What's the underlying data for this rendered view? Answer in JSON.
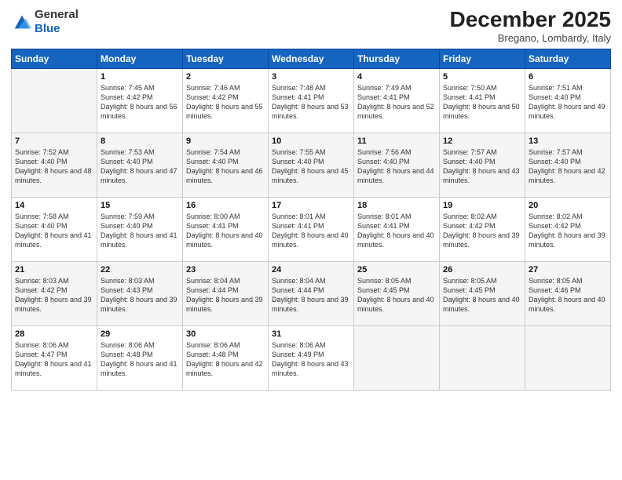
{
  "header": {
    "logo_line1": "General",
    "logo_line2": "Blue",
    "month": "December 2025",
    "location": "Bregano, Lombardy, Italy"
  },
  "days_of_week": [
    "Sunday",
    "Monday",
    "Tuesday",
    "Wednesday",
    "Thursday",
    "Friday",
    "Saturday"
  ],
  "weeks": [
    [
      {
        "day": "",
        "sunrise": "",
        "sunset": "",
        "daylight": "",
        "empty": true
      },
      {
        "day": "1",
        "sunrise": "Sunrise: 7:45 AM",
        "sunset": "Sunset: 4:42 PM",
        "daylight": "Daylight: 8 hours and 56 minutes."
      },
      {
        "day": "2",
        "sunrise": "Sunrise: 7:46 AM",
        "sunset": "Sunset: 4:42 PM",
        "daylight": "Daylight: 8 hours and 55 minutes."
      },
      {
        "day": "3",
        "sunrise": "Sunrise: 7:48 AM",
        "sunset": "Sunset: 4:41 PM",
        "daylight": "Daylight: 8 hours and 53 minutes."
      },
      {
        "day": "4",
        "sunrise": "Sunrise: 7:49 AM",
        "sunset": "Sunset: 4:41 PM",
        "daylight": "Daylight: 8 hours and 52 minutes."
      },
      {
        "day": "5",
        "sunrise": "Sunrise: 7:50 AM",
        "sunset": "Sunset: 4:41 PM",
        "daylight": "Daylight: 8 hours and 50 minutes."
      },
      {
        "day": "6",
        "sunrise": "Sunrise: 7:51 AM",
        "sunset": "Sunset: 4:40 PM",
        "daylight": "Daylight: 8 hours and 49 minutes."
      }
    ],
    [
      {
        "day": "7",
        "sunrise": "Sunrise: 7:52 AM",
        "sunset": "Sunset: 4:40 PM",
        "daylight": "Daylight: 8 hours and 48 minutes."
      },
      {
        "day": "8",
        "sunrise": "Sunrise: 7:53 AM",
        "sunset": "Sunset: 4:40 PM",
        "daylight": "Daylight: 8 hours and 47 minutes."
      },
      {
        "day": "9",
        "sunrise": "Sunrise: 7:54 AM",
        "sunset": "Sunset: 4:40 PM",
        "daylight": "Daylight: 8 hours and 46 minutes."
      },
      {
        "day": "10",
        "sunrise": "Sunrise: 7:55 AM",
        "sunset": "Sunset: 4:40 PM",
        "daylight": "Daylight: 8 hours and 45 minutes."
      },
      {
        "day": "11",
        "sunrise": "Sunrise: 7:56 AM",
        "sunset": "Sunset: 4:40 PM",
        "daylight": "Daylight: 8 hours and 44 minutes."
      },
      {
        "day": "12",
        "sunrise": "Sunrise: 7:57 AM",
        "sunset": "Sunset: 4:40 PM",
        "daylight": "Daylight: 8 hours and 43 minutes."
      },
      {
        "day": "13",
        "sunrise": "Sunrise: 7:57 AM",
        "sunset": "Sunset: 4:40 PM",
        "daylight": "Daylight: 8 hours and 42 minutes."
      }
    ],
    [
      {
        "day": "14",
        "sunrise": "Sunrise: 7:58 AM",
        "sunset": "Sunset: 4:40 PM",
        "daylight": "Daylight: 8 hours and 41 minutes."
      },
      {
        "day": "15",
        "sunrise": "Sunrise: 7:59 AM",
        "sunset": "Sunset: 4:40 PM",
        "daylight": "Daylight: 8 hours and 41 minutes."
      },
      {
        "day": "16",
        "sunrise": "Sunrise: 8:00 AM",
        "sunset": "Sunset: 4:41 PM",
        "daylight": "Daylight: 8 hours and 40 minutes."
      },
      {
        "day": "17",
        "sunrise": "Sunrise: 8:01 AM",
        "sunset": "Sunset: 4:41 PM",
        "daylight": "Daylight: 8 hours and 40 minutes."
      },
      {
        "day": "18",
        "sunrise": "Sunrise: 8:01 AM",
        "sunset": "Sunset: 4:41 PM",
        "daylight": "Daylight: 8 hours and 40 minutes."
      },
      {
        "day": "19",
        "sunrise": "Sunrise: 8:02 AM",
        "sunset": "Sunset: 4:42 PM",
        "daylight": "Daylight: 8 hours and 39 minutes."
      },
      {
        "day": "20",
        "sunrise": "Sunrise: 8:02 AM",
        "sunset": "Sunset: 4:42 PM",
        "daylight": "Daylight: 8 hours and 39 minutes."
      }
    ],
    [
      {
        "day": "21",
        "sunrise": "Sunrise: 8:03 AM",
        "sunset": "Sunset: 4:42 PM",
        "daylight": "Daylight: 8 hours and 39 minutes."
      },
      {
        "day": "22",
        "sunrise": "Sunrise: 8:03 AM",
        "sunset": "Sunset: 4:43 PM",
        "daylight": "Daylight: 8 hours and 39 minutes."
      },
      {
        "day": "23",
        "sunrise": "Sunrise: 8:04 AM",
        "sunset": "Sunset: 4:44 PM",
        "daylight": "Daylight: 8 hours and 39 minutes."
      },
      {
        "day": "24",
        "sunrise": "Sunrise: 8:04 AM",
        "sunset": "Sunset: 4:44 PM",
        "daylight": "Daylight: 8 hours and 39 minutes."
      },
      {
        "day": "25",
        "sunrise": "Sunrise: 8:05 AM",
        "sunset": "Sunset: 4:45 PM",
        "daylight": "Daylight: 8 hours and 40 minutes."
      },
      {
        "day": "26",
        "sunrise": "Sunrise: 8:05 AM",
        "sunset": "Sunset: 4:45 PM",
        "daylight": "Daylight: 8 hours and 40 minutes."
      },
      {
        "day": "27",
        "sunrise": "Sunrise: 8:05 AM",
        "sunset": "Sunset: 4:46 PM",
        "daylight": "Daylight: 8 hours and 40 minutes."
      }
    ],
    [
      {
        "day": "28",
        "sunrise": "Sunrise: 8:06 AM",
        "sunset": "Sunset: 4:47 PM",
        "daylight": "Daylight: 8 hours and 41 minutes."
      },
      {
        "day": "29",
        "sunrise": "Sunrise: 8:06 AM",
        "sunset": "Sunset: 4:48 PM",
        "daylight": "Daylight: 8 hours and 41 minutes."
      },
      {
        "day": "30",
        "sunrise": "Sunrise: 8:06 AM",
        "sunset": "Sunset: 4:48 PM",
        "daylight": "Daylight: 8 hours and 42 minutes."
      },
      {
        "day": "31",
        "sunrise": "Sunrise: 8:06 AM",
        "sunset": "Sunset: 4:49 PM",
        "daylight": "Daylight: 8 hours and 43 minutes."
      },
      {
        "day": "",
        "sunrise": "",
        "sunset": "",
        "daylight": "",
        "empty": true
      },
      {
        "day": "",
        "sunrise": "",
        "sunset": "",
        "daylight": "",
        "empty": true
      },
      {
        "day": "",
        "sunrise": "",
        "sunset": "",
        "daylight": "",
        "empty": true
      }
    ]
  ]
}
